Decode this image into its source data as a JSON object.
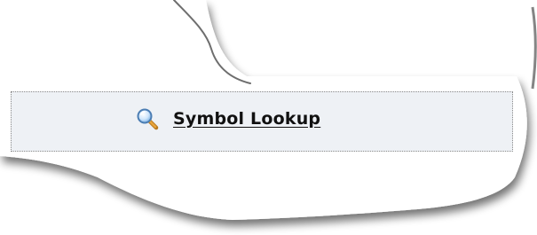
{
  "lookup": {
    "label": "Symbol Lookup",
    "icon": "search-icon"
  },
  "colors": {
    "bar_background": "#eef1f5",
    "bar_border": "#8a8a8a",
    "link_text": "#111111"
  }
}
